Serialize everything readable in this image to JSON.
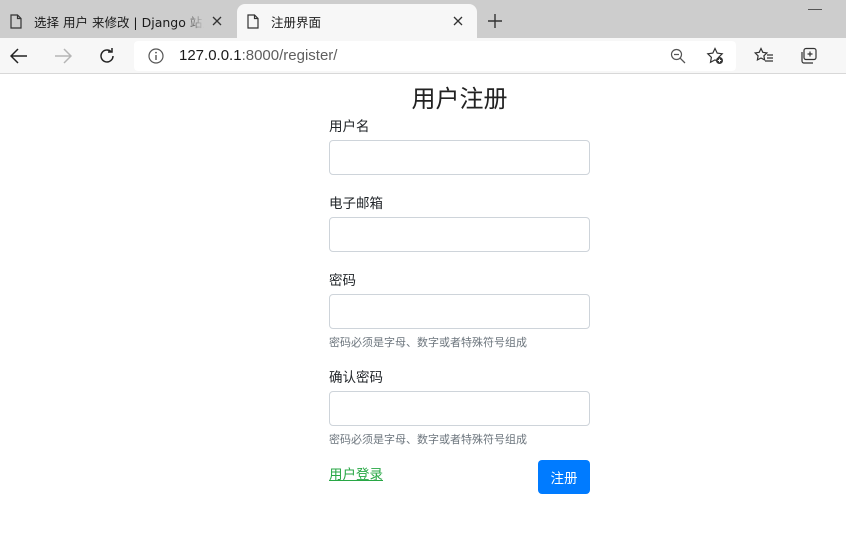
{
  "browser": {
    "tabs": [
      {
        "title": "选择 用户 来修改 | Django 站点管理",
        "active": false
      },
      {
        "title": "注册界面",
        "active": true
      }
    ],
    "url_host": "127.0.0.1",
    "url_rest": ":8000/register/"
  },
  "form": {
    "heading": "用户注册",
    "username_label": "用户名",
    "email_label": "电子邮箱",
    "password_label": "密码",
    "password_help": "密码必须是字母、数字或者特殊符号组成",
    "confirm_label": "确认密码",
    "confirm_help": "密码必须是字母、数字或者特殊符号组成",
    "login_link": "用户登录",
    "submit_label": "注册"
  },
  "colors": {
    "submit_bg": "#007bff",
    "link": "#28a745",
    "help_text": "#6c757d"
  }
}
